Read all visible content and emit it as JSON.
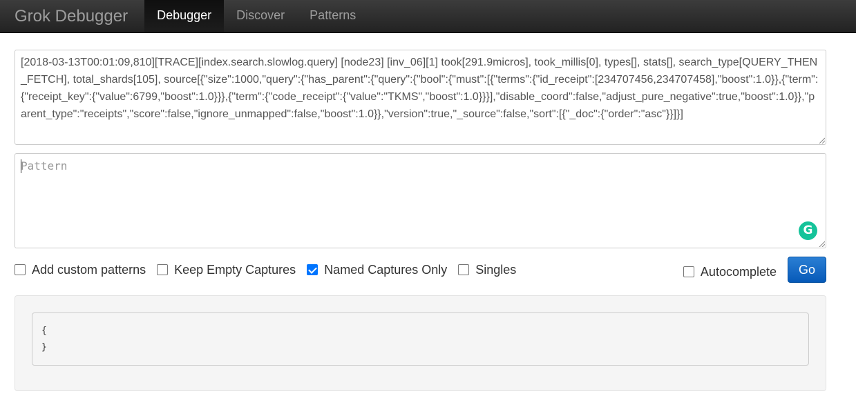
{
  "navbar": {
    "brand": "Grok Debugger",
    "items": [
      {
        "label": "Debugger",
        "active": true
      },
      {
        "label": "Discover",
        "active": false
      },
      {
        "label": "Patterns",
        "active": false
      }
    ]
  },
  "input": {
    "value": "[2018-03-13T00:01:09,810][TRACE][index.search.slowlog.query] [node23] [inv_06][1] took[291.9micros], took_millis[0], types[], stats[], search_type[QUERY_THEN_FETCH], total_shards[105], source[{\"size\":1000,\"query\":{\"has_parent\":{\"query\":{\"bool\":{\"must\":[{\"terms\":{\"id_receipt\":[234707456,234707458],\"boost\":1.0}},{\"term\":{\"receipt_key\":{\"value\":6799,\"boost\":1.0}}},{\"term\":{\"code_receipt\":{\"value\":\"TKMS\",\"boost\":1.0}}}],\"disable_coord\":false,\"adjust_pure_negative\":true,\"boost\":1.0}},\"parent_type\":\"receipts\",\"score\":false,\"ignore_unmapped\":false,\"boost\":1.0}},\"version\":true,\"_source\":false,\"sort\":[{\"_doc\":{\"order\":\"asc\"}}]}]"
  },
  "pattern": {
    "placeholder": "Pattern",
    "grammarly_letter": "G"
  },
  "options": {
    "add_custom_patterns": {
      "label": "Add custom patterns",
      "checked": false
    },
    "keep_empty_captures": {
      "label": "Keep Empty Captures",
      "checked": false
    },
    "named_captures_only": {
      "label": "Named Captures Only",
      "checked": true
    },
    "singles": {
      "label": "Singles",
      "checked": false
    },
    "autocomplete": {
      "label": "Autocomplete",
      "checked": false
    },
    "go_label": "Go"
  },
  "output": {
    "text": "{\n}"
  },
  "colors": {
    "navbar": "#222222",
    "primary_button": "#0a67c7",
    "checkbox_checked": "#0075ff",
    "grammarly": "#15c39a"
  }
}
